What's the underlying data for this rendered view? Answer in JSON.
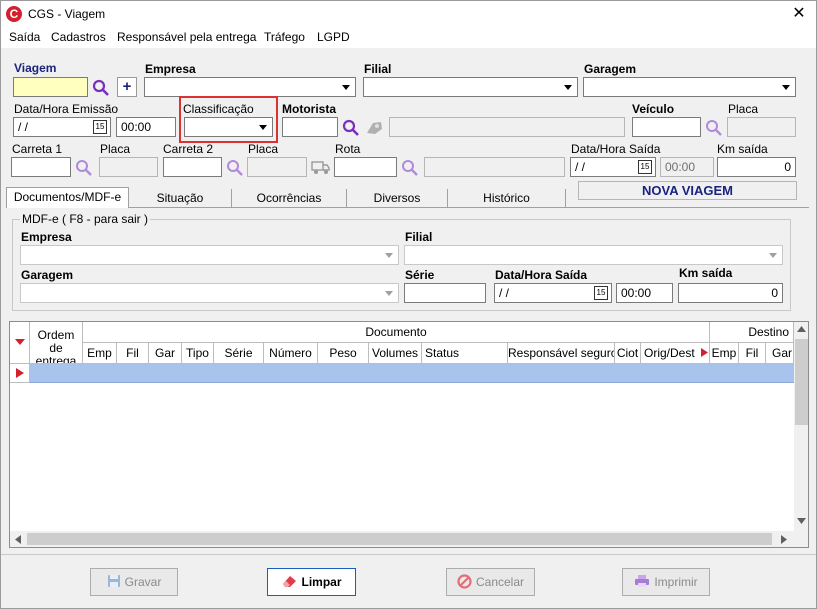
{
  "window": {
    "title": "CGS - Viagem",
    "close_glyph": "✕"
  },
  "menu": [
    "Saída",
    "Cadastros",
    "Responsável pela entrega",
    "Tráfego",
    "LGPD"
  ],
  "form": {
    "viagem_label": "Viagem",
    "empresa_label": "Empresa",
    "filial_label": "Filial",
    "garagem_label": "Garagem",
    "data_emissao_label": "Data/Hora Emissão",
    "data_emissao_value": " /  /",
    "hora_emissao_value": "00:00",
    "classificacao_label": "Classificação",
    "motorista_label": "Motorista",
    "veiculo_label": "Veículo",
    "placa_label": "Placa",
    "carreta1_label": "Carreta 1",
    "placa2_label": "Placa",
    "carreta2_label": "Carreta 2",
    "placa3_label": "Placa",
    "rota_label": "Rota",
    "data_saida_label": "Data/Hora Saída",
    "data_saida_value": " /  /",
    "hora_saida_value": "00:00",
    "km_saida_label": "Km saída",
    "km_saida_value": "0",
    "status_text": "NOVA VIAGEM",
    "cal_text": "15"
  },
  "tabs": [
    "Documentos/MDF-e",
    "Situação",
    "Ocorrências",
    "Diversos",
    "Histórico"
  ],
  "mdfe": {
    "group_label": "MDF-e ( F8 - para sair )",
    "empresa_label": "Empresa",
    "filial_label": "Filial",
    "garagem_label": "Garagem",
    "serie_label": "Série",
    "data_saida_label": "Data/Hora Saída",
    "data_saida_value": " /  /",
    "hora_saida_value": "00:00",
    "km_saida_label": "Km saída",
    "km_saida_value": "0"
  },
  "grid": {
    "ordem_label": "Ordem de entrega",
    "documento_label": "Documento",
    "destino_label": "Destino",
    "columns": [
      "Emp",
      "Fil",
      "Gar",
      "Tipo",
      "Série",
      "Número",
      "Peso",
      "Volumes",
      "Status",
      "Responsável seguro",
      "Ciot",
      "Orig/Dest",
      "Emp",
      "Fil",
      "Gar"
    ]
  },
  "buttons": {
    "gravar": "Gravar",
    "limpar": "Limpar",
    "cancelar": "Cancelar",
    "imprimir": "Imprimir"
  },
  "colors": {
    "accent": "#d4202e",
    "navy": "#1a237e",
    "magnifier": "#7b2fbe",
    "highlight": "#dc3232",
    "row_selected": "#a8c4ec"
  }
}
